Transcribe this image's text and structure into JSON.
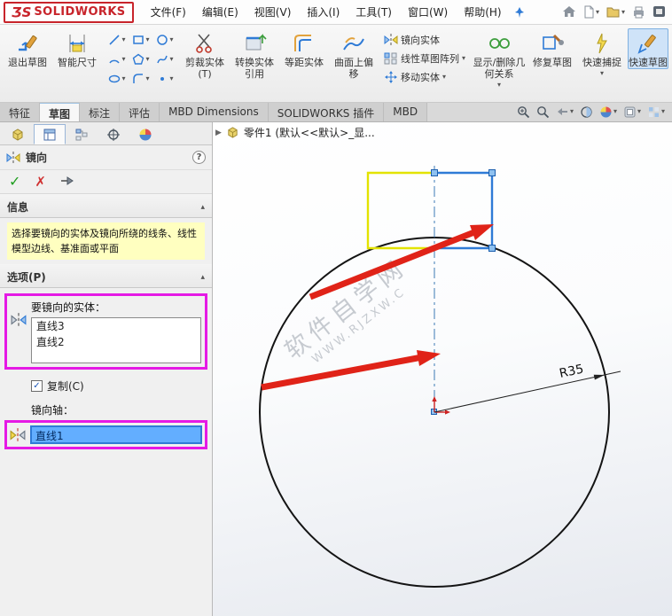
{
  "icons": {
    "caret": "▾",
    "check": "✓",
    "cancel": "✗",
    "help": "?",
    "flyout": "▶",
    "collapse": "▴",
    "checkbox_check": "✓"
  },
  "titlebar": {
    "logo_3s": "ƷS",
    "logo_text": "SOLIDWORKS",
    "menus": [
      "文件(F)",
      "编辑(E)",
      "视图(V)",
      "插入(I)",
      "工具(T)",
      "窗口(W)",
      "帮助(H)"
    ]
  },
  "ribbon": {
    "exit_sketch": "退出草图",
    "smart_dimension": "智能尺寸",
    "trim_entities": "剪裁实体(T)",
    "convert_entities": "转换实体引用",
    "offset_entities": "等距实体",
    "offset_on_surface": "曲面上偏移",
    "mirror_entities": "镜向实体",
    "linear_pattern": "线性草图阵列",
    "move_entities": "移动实体",
    "display_delete_relations": "显示/删除几何关系",
    "repair_sketch": "修复草图",
    "quick_snaps": "快速捕捉",
    "rapid_sketch": "快速草图"
  },
  "tabs": [
    "特征",
    "草图",
    "标注",
    "评估",
    "MBD Dimensions",
    "SOLIDWORKS 插件",
    "MBD"
  ],
  "panel": {
    "title": "镜向",
    "info_header": "信息",
    "info_message": "选择要镜向的实体及镜向所绕的线条、线性模型边线、基准面或平面",
    "options_header": "选项(P)",
    "entities_label": "要镜向的实体：",
    "entities": [
      "直线3",
      "直线2"
    ],
    "copy_label": "复制(C)",
    "axis_label": "镜向轴：",
    "axis_value": "直线1"
  },
  "graphics": {
    "breadcrumb": "零件1 (默认<<默认>_显...",
    "dimension_label": "R35",
    "watermark_line1": "软件自学网",
    "watermark_line2": "WWW.RJZXW.C"
  },
  "colors": {
    "annotation_magenta": "#e51ae5",
    "selection_blue": "#2f7bd6",
    "sketch_yellow": "#e8e800",
    "info_yellow": "#ffffc0",
    "arrow_red": "#e02318",
    "logo_red": "#c8242b"
  }
}
